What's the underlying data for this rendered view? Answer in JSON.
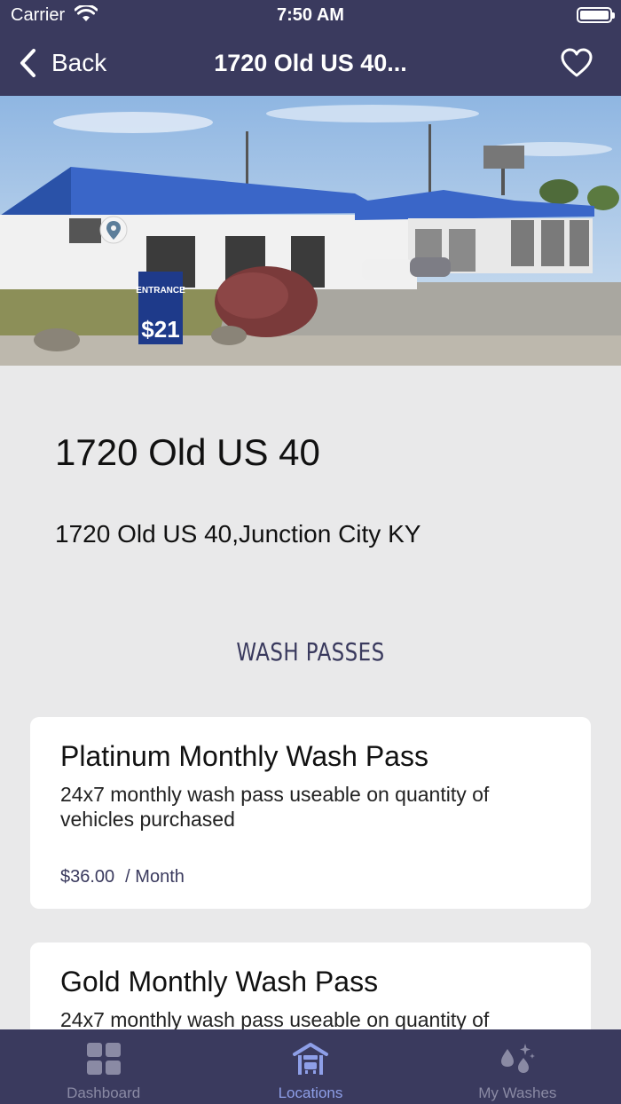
{
  "status_bar": {
    "carrier": "Carrier",
    "time": "7:50 AM"
  },
  "nav": {
    "back_label": "Back",
    "title": "1720 Old US 40..."
  },
  "location": {
    "name": "1720 Old US 40",
    "address": "1720 Old US 40,Junction City KY"
  },
  "hero_sign": {
    "line1": "ENTRANCE",
    "price": "$21"
  },
  "wash_passes": {
    "heading": "WASH PASSES",
    "items": [
      {
        "title": "Platinum Monthly Wash Pass",
        "description": "24x7 monthly wash pass useable on quantity of vehicles purchased",
        "price": "$36.00",
        "period": "/ Month"
      },
      {
        "title": "Gold Monthly Wash Pass",
        "description": "24x7 monthly wash pass useable on quantity of",
        "price": "",
        "period": ""
      }
    ]
  },
  "tabs": [
    {
      "label": "Dashboard",
      "icon": "dashboard-icon",
      "active": false
    },
    {
      "label": "Locations",
      "icon": "locations-icon",
      "active": true
    },
    {
      "label": "My Washes",
      "icon": "my-washes-icon",
      "active": false
    }
  ],
  "colors": {
    "primary": "#3a3a5e",
    "background": "#e9e9ea",
    "tab_active": "#8e9fe8",
    "tab_inactive": "#8a8aa4"
  }
}
